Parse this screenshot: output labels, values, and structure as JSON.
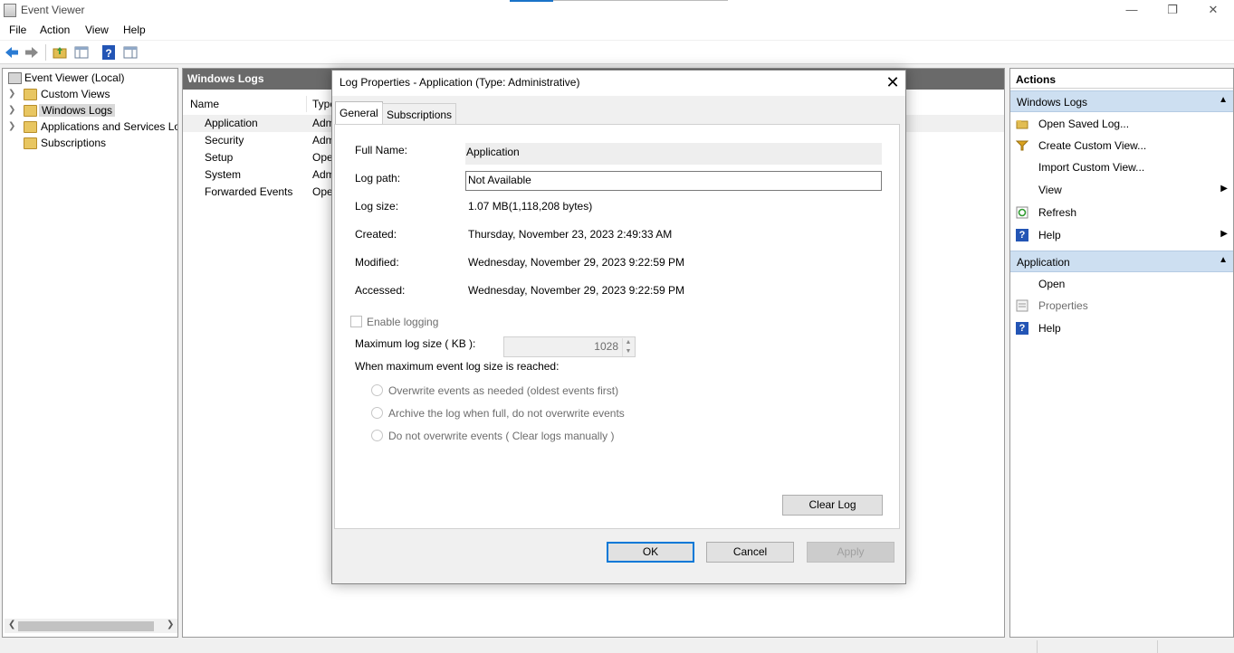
{
  "window": {
    "title": "Event Viewer",
    "minimize": "—",
    "restore": "❐",
    "close": "✕"
  },
  "menu": [
    "File",
    "Action",
    "View",
    "Help"
  ],
  "tree": {
    "root": "Event Viewer (Local)",
    "items": [
      "Custom Views",
      "Windows Logs",
      "Applications and Services Lo",
      "Subscriptions"
    ],
    "selected": "Windows Logs"
  },
  "middle": {
    "header": "Windows Logs",
    "columns": [
      "Name",
      "Type"
    ],
    "rows": [
      {
        "name": "Application",
        "type": "Adm"
      },
      {
        "name": "Security",
        "type": "Adm"
      },
      {
        "name": "Setup",
        "type": "Ope"
      },
      {
        "name": "System",
        "type": "Adm"
      },
      {
        "name": "Forwarded Events",
        "type": "Ope"
      }
    ]
  },
  "actions": {
    "title": "Actions",
    "sections": [
      {
        "title": "Windows Logs",
        "items": [
          {
            "label": "Open Saved Log...",
            "icon": "open-folder-icon"
          },
          {
            "label": "Create Custom View...",
            "icon": "filter-icon"
          },
          {
            "label": "Import Custom View...",
            "icon": ""
          },
          {
            "label": "View",
            "icon": "",
            "submenu": true
          },
          {
            "label": "Refresh",
            "icon": "refresh-icon"
          },
          {
            "label": "Help",
            "icon": "help-icon",
            "submenu": true
          }
        ]
      },
      {
        "title": "Application",
        "items": [
          {
            "label": "Open",
            "icon": ""
          },
          {
            "label": "Properties",
            "icon": "properties-icon",
            "disabled": true
          },
          {
            "label": "Help",
            "icon": "help-icon"
          }
        ]
      }
    ]
  },
  "dialog": {
    "title": "Log Properties - Application (Type: Administrative)",
    "tabs": [
      "General",
      "Subscriptions"
    ],
    "active_tab": "General",
    "fields": {
      "full_name_label": "Full Name:",
      "full_name": "Application",
      "log_path_label": "Log path:",
      "log_path": "Not Available",
      "log_size_label": "Log size:",
      "log_size": "1.07 MB(1,118,208 bytes)",
      "created_label": "Created:",
      "created": "Thursday, November 23, 2023 2:49:33 AM",
      "modified_label": "Modified:",
      "modified": "Wednesday, November 29, 2023 9:22:59 PM",
      "accessed_label": "Accessed:",
      "accessed": "Wednesday, November 29, 2023 9:22:59 PM"
    },
    "enable_logging": "Enable logging",
    "enable_logging_checked": false,
    "max_size_label": "Maximum log size ( KB ):",
    "max_size_value": "1028",
    "when_full_label": "When maximum event log size is reached:",
    "options": [
      "Overwrite events as needed (oldest events first)",
      "Archive the log when full, do not overwrite events",
      "Do not overwrite events ( Clear logs manually )"
    ],
    "clear_log": "Clear Log",
    "ok": "OK",
    "cancel": "Cancel",
    "apply": "Apply"
  }
}
